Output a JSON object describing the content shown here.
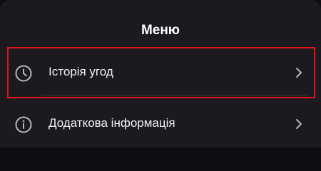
{
  "menu": {
    "title": "Меню",
    "items": [
      {
        "label": "Історія угод",
        "icon": "clock-icon",
        "highlighted": true
      },
      {
        "label": "Додаткова інформація",
        "icon": "info-icon",
        "highlighted": false
      }
    ]
  },
  "colors": {
    "background": "#1c1a1f",
    "text": "#f1f0f2",
    "icon": "#b8b6bb",
    "highlight": "#e3141c"
  }
}
